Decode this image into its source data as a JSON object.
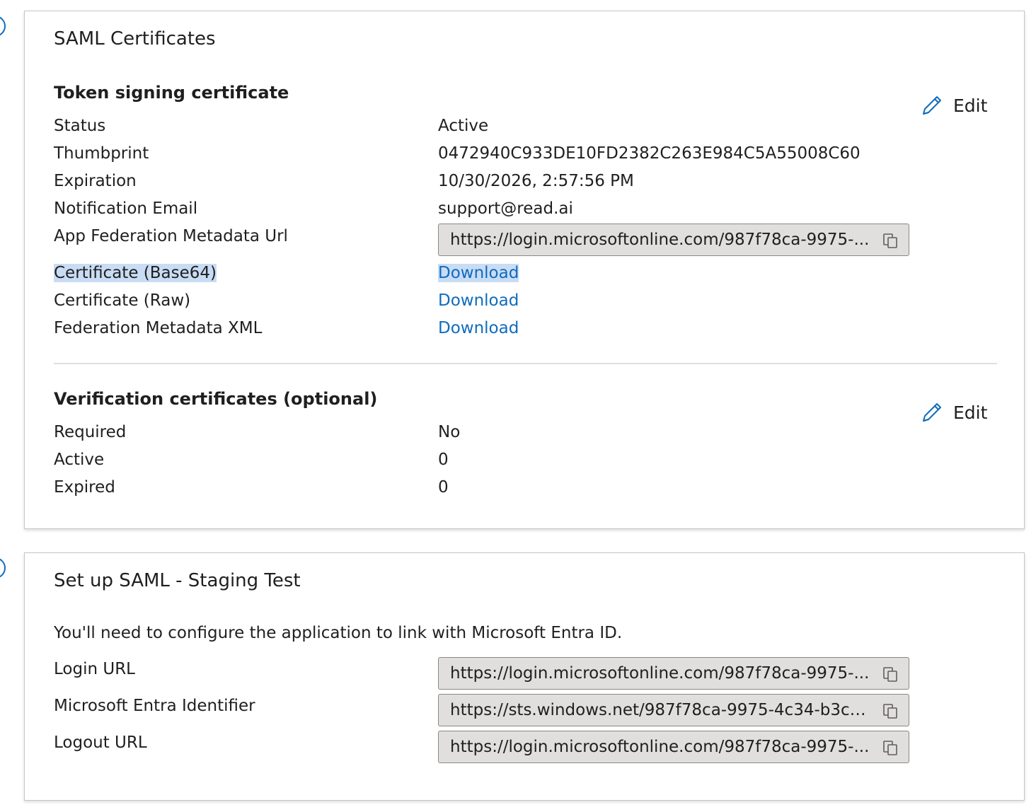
{
  "saml_certificates": {
    "title": "SAML Certificates",
    "token_signing": {
      "heading": "Token signing certificate",
      "edit_label": "Edit",
      "rows": [
        {
          "label": "Status",
          "value": "Active"
        },
        {
          "label": "Thumbprint",
          "value": "0472940C933DE10FD2382C263E984C5A55008C60"
        },
        {
          "label": "Expiration",
          "value": "10/30/2026, 2:57:56 PM"
        },
        {
          "label": "Notification Email",
          "value": "support@read.ai"
        },
        {
          "label": "App Federation Metadata Url",
          "value": "https://login.microsoftonline.com/987f78ca-9975-..."
        },
        {
          "label": "Certificate (Base64)",
          "value": "Download"
        },
        {
          "label": "Certificate (Raw)",
          "value": "Download"
        },
        {
          "label": "Federation Metadata XML",
          "value": "Download"
        }
      ]
    },
    "verification": {
      "heading": "Verification certificates (optional)",
      "edit_label": "Edit",
      "rows": [
        {
          "label": "Required",
          "value": "No"
        },
        {
          "label": "Active",
          "value": "0"
        },
        {
          "label": "Expired",
          "value": "0"
        }
      ]
    }
  },
  "setup_saml": {
    "title": "Set up SAML - Staging Test",
    "intro": "You'll need to configure the application to link with Microsoft Entra ID.",
    "rows": [
      {
        "label": "Login URL",
        "value": "https://login.microsoftonline.com/987f78ca-9975-..."
      },
      {
        "label": "Microsoft Entra Identifier",
        "value": "https://sts.windows.net/987f78ca-9975-4c34-b3ce..."
      },
      {
        "label": "Logout URL",
        "value": "https://login.microsoftonline.com/987f78ca-9975-..."
      }
    ]
  },
  "icons": {
    "edit": "pencil-icon",
    "copy": "copy-icon"
  },
  "colors": {
    "link": "#0f6cbd",
    "selection": "#c9dcf5",
    "field_bg": "#e1dfdd"
  }
}
